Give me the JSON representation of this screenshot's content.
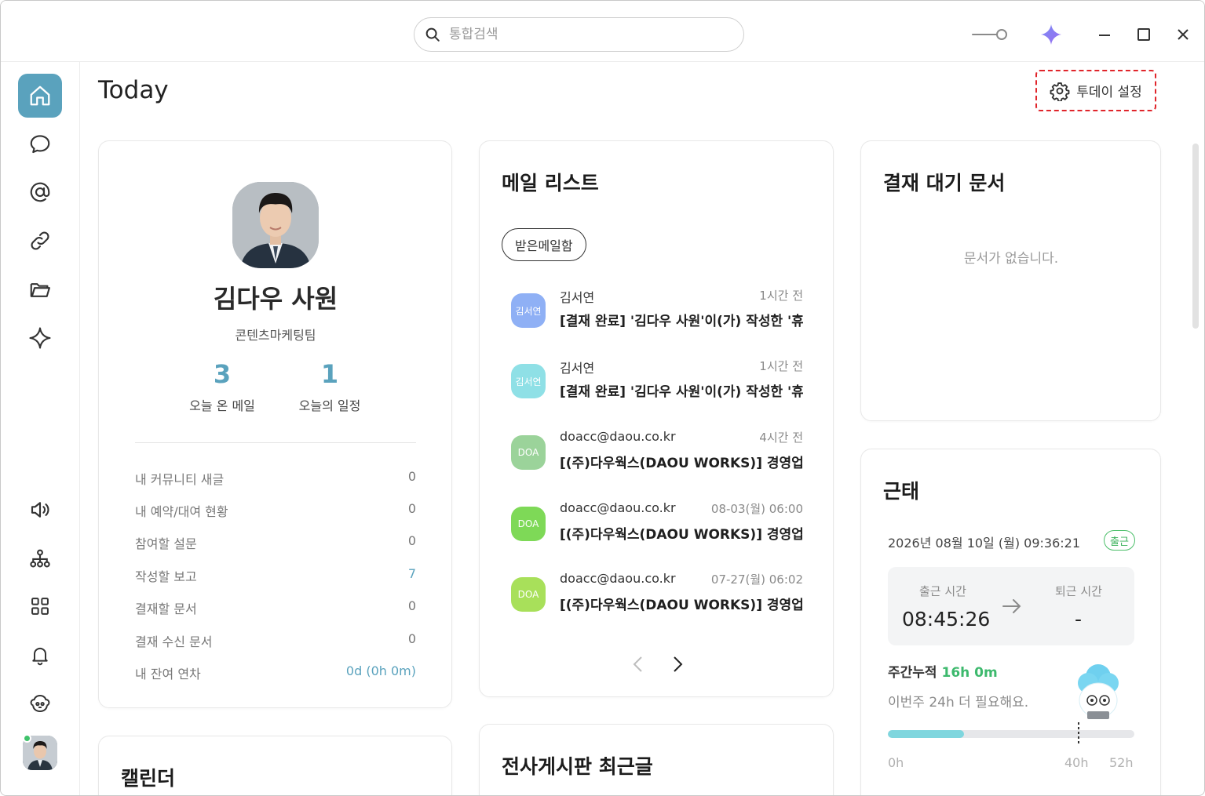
{
  "search": {
    "placeholder": "통합검색"
  },
  "header": {
    "title": "Today",
    "settings_label": "투데이 설정"
  },
  "profile": {
    "name": "김다우 사원",
    "team": "콘텐츠마케팅팀",
    "stats": [
      {
        "num": "3",
        "label": "오늘 온 메일"
      },
      {
        "num": "1",
        "label": "오늘의 일정"
      }
    ],
    "rows": [
      {
        "label": "내 커뮤니티 새글",
        "value": "0"
      },
      {
        "label": "내 예약/대여 현황",
        "value": "0"
      },
      {
        "label": "참여할 설문",
        "value": "0"
      },
      {
        "label": "작성할 보고",
        "value": "7"
      },
      {
        "label": "결재할 문서",
        "value": "0"
      },
      {
        "label": "결재 수신 문서",
        "value": "0"
      },
      {
        "label": "내 잔여 연차",
        "value": "0d (0h 0m)"
      }
    ]
  },
  "mail": {
    "title": "메일 리스트",
    "folder": "받은메일함",
    "items": [
      {
        "avatar": "김서연",
        "from": "김서연",
        "time": "1시간 전",
        "subject": "[결재 완료] '김다우 사원'이(가) 작성한 '휴",
        "color": "#8fb0f5"
      },
      {
        "avatar": "김서연",
        "from": "김서연",
        "time": "1시간 전",
        "subject": "[결재 완료] '김다우 사원'이(가) 작성한 '휴",
        "color": "#8fe0e6"
      },
      {
        "avatar": "DOA",
        "from": "doacc@daou.co.kr",
        "time": "4시간 전",
        "subject": "[(주)다우웍스(DAOU WORKS)] 경영업!",
        "color": "#9bd39a"
      },
      {
        "avatar": "DOA",
        "from": "doacc@daou.co.kr",
        "time": "08-03(월) 06:00",
        "subject": "[(주)다우웍스(DAOU WORKS)] 경영업!",
        "color": "#7ed957"
      },
      {
        "avatar": "DOA",
        "from": "doacc@daou.co.kr",
        "time": "07-27(월) 06:02",
        "subject": "[(주)다우웍스(DAOU WORKS)] 경영업!",
        "color": "#a8e05a"
      }
    ]
  },
  "approval": {
    "title": "결재 대기 문서",
    "empty": "문서가 없습니다."
  },
  "attendance": {
    "title": "근태",
    "datetime": "2026년 08월 10일 (월) 09:36:21",
    "status": "출근",
    "in_label": "출근 시간",
    "in_time": "08:45:26",
    "out_label": "퇴근 시간",
    "out_time": "-",
    "weekly_label": "주간누적",
    "weekly_value": "16h 0m",
    "need_text": "이번주 24h 더 필요해요.",
    "progress_fraction": 0.31,
    "ticks": [
      "0h",
      "40h",
      "52h"
    ]
  },
  "calendar": {
    "title": "캘린더"
  },
  "board": {
    "title": "전사게시판 최근글"
  }
}
